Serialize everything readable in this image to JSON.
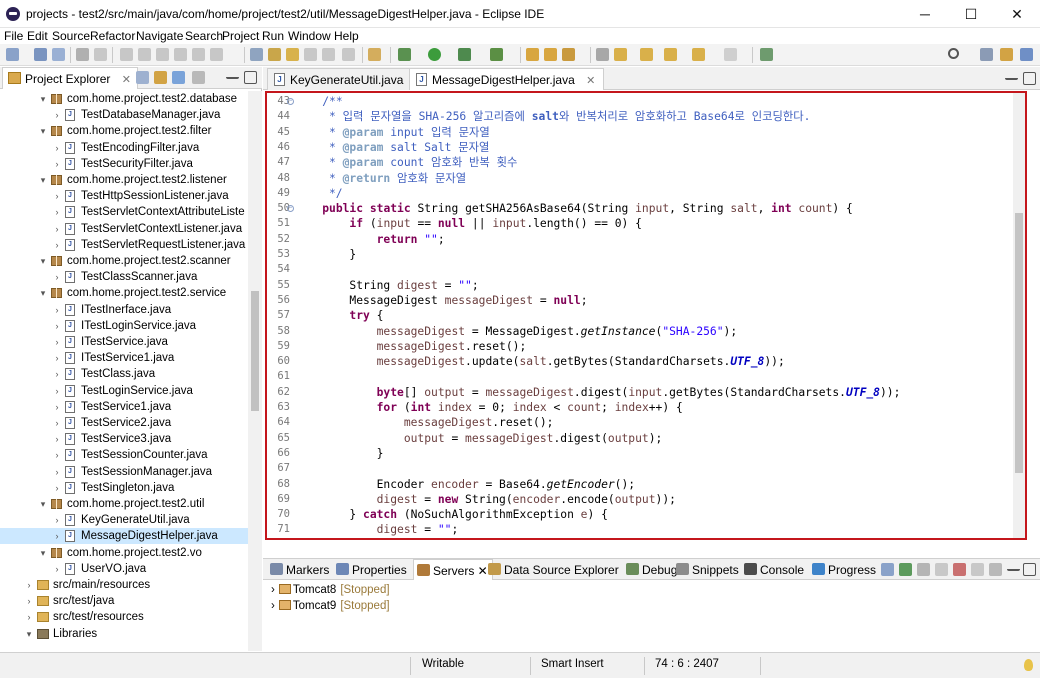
{
  "window": {
    "title": "projects - test2/src/main/java/com/home/project/test2/util/MessageDigestHelper.java - Eclipse IDE",
    "minimize_glyph": "─",
    "maximize_glyph": "☐",
    "close_glyph": "✕"
  },
  "menu": [
    "File",
    "Edit",
    "Source",
    "Refactor",
    "Navigate",
    "Search",
    "Project",
    "Run",
    "Window",
    "Help"
  ],
  "project_explorer": {
    "title": "Project Explorer",
    "close_glyph": "✕",
    "rows": [
      {
        "kind": "package",
        "label": "com.home.project.test2.database",
        "indent": 3,
        "arrow": "▾"
      },
      {
        "kind": "file",
        "label": "TestDatabaseManager.java",
        "indent": 4,
        "arrow": "›"
      },
      {
        "kind": "package",
        "label": "com.home.project.test2.filter",
        "indent": 3,
        "arrow": "▾"
      },
      {
        "kind": "file",
        "label": "TestEncodingFilter.java",
        "indent": 4,
        "arrow": "›"
      },
      {
        "kind": "file",
        "label": "TestSecurityFilter.java",
        "indent": 4,
        "arrow": "›"
      },
      {
        "kind": "package",
        "label": "com.home.project.test2.listener",
        "indent": 3,
        "arrow": "▾"
      },
      {
        "kind": "file",
        "label": "TestHttpSessionListener.java",
        "indent": 4,
        "arrow": "›"
      },
      {
        "kind": "file",
        "label": "TestServletContextAttributeListe",
        "indent": 4,
        "arrow": "›"
      },
      {
        "kind": "file",
        "label": "TestServletContextListener.java",
        "indent": 4,
        "arrow": "›"
      },
      {
        "kind": "file",
        "label": "TestServletRequestListener.java",
        "indent": 4,
        "arrow": "›"
      },
      {
        "kind": "package",
        "label": "com.home.project.test2.scanner",
        "indent": 3,
        "arrow": "▾"
      },
      {
        "kind": "file",
        "label": "TestClassScanner.java",
        "indent": 4,
        "arrow": "›"
      },
      {
        "kind": "package",
        "label": "com.home.project.test2.service",
        "indent": 3,
        "arrow": "▾"
      },
      {
        "kind": "ifile",
        "label": "ITestInerface.java",
        "indent": 4,
        "arrow": "›"
      },
      {
        "kind": "ifile",
        "label": "ITestLoginService.java",
        "indent": 4,
        "arrow": "›"
      },
      {
        "kind": "ifile",
        "label": "ITestService.java",
        "indent": 4,
        "arrow": "›"
      },
      {
        "kind": "ifile",
        "label": "ITestService1.java",
        "indent": 4,
        "arrow": "›"
      },
      {
        "kind": "file",
        "label": "TestClass.java",
        "indent": 4,
        "arrow": "›"
      },
      {
        "kind": "file",
        "label": "TestLoginService.java",
        "indent": 4,
        "arrow": "›"
      },
      {
        "kind": "file",
        "label": "TestService1.java",
        "indent": 4,
        "arrow": "›"
      },
      {
        "kind": "file",
        "label": "TestService2.java",
        "indent": 4,
        "arrow": "›"
      },
      {
        "kind": "file",
        "label": "TestService3.java",
        "indent": 4,
        "arrow": "›"
      },
      {
        "kind": "file",
        "label": "TestSessionCounter.java",
        "indent": 4,
        "arrow": "›"
      },
      {
        "kind": "file",
        "label": "TestSessionManager.java",
        "indent": 4,
        "arrow": "›"
      },
      {
        "kind": "file",
        "label": "TestSingleton.java",
        "indent": 4,
        "arrow": "›"
      },
      {
        "kind": "package",
        "label": "com.home.project.test2.util",
        "indent": 3,
        "arrow": "▾"
      },
      {
        "kind": "file",
        "label": "KeyGenerateUtil.java",
        "indent": 4,
        "arrow": "›"
      },
      {
        "kind": "file",
        "label": "MessageDigestHelper.java",
        "indent": 4,
        "arrow": "›",
        "selected": true
      },
      {
        "kind": "package",
        "label": "com.home.project.test2.vo",
        "indent": 3,
        "arrow": "▾"
      },
      {
        "kind": "file",
        "label": "UserVO.java",
        "indent": 4,
        "arrow": "›"
      },
      {
        "kind": "folder",
        "label": "src/main/resources",
        "indent": 2,
        "arrow": "›"
      },
      {
        "kind": "folder",
        "label": "src/test/java",
        "indent": 2,
        "arrow": "›"
      },
      {
        "kind": "folder",
        "label": "src/test/resources",
        "indent": 2,
        "arrow": "›"
      },
      {
        "kind": "library",
        "label": "Libraries",
        "indent": 2,
        "arrow": "▾"
      }
    ]
  },
  "editor": {
    "tabs": [
      {
        "label": "KeyGenerateUtil.java",
        "active": false
      },
      {
        "label": "MessageDigestHelper.java",
        "active": true
      }
    ],
    "lines": [
      {
        "n": "43",
        "fold": "⊖",
        "tokens": [
          [
            "",
            "    "
          ],
          [
            "c-com",
            "/**"
          ]
        ]
      },
      {
        "n": "44",
        "tokens": [
          [
            "c-com",
            "     * 입력 문자열을 SHA-256 알고리즘에 "
          ],
          [
            "c-com c-bold",
            "salt"
          ],
          [
            "c-com",
            "와 반복처리로 암호화하고 Base64로 인코딩한다."
          ]
        ]
      },
      {
        "n": "45",
        "tokens": [
          [
            "c-com",
            "     * "
          ],
          [
            "c-tag",
            "@param"
          ],
          [
            "c-com",
            " input 입력 문자열"
          ]
        ]
      },
      {
        "n": "46",
        "tokens": [
          [
            "c-com",
            "     * "
          ],
          [
            "c-tag",
            "@param"
          ],
          [
            "c-com",
            " salt Salt 문자열"
          ]
        ]
      },
      {
        "n": "47",
        "tokens": [
          [
            "c-com",
            "     * "
          ],
          [
            "c-tag",
            "@param"
          ],
          [
            "c-com",
            " count 암호화 반복 횟수"
          ]
        ]
      },
      {
        "n": "48",
        "tokens": [
          [
            "c-com",
            "     * "
          ],
          [
            "c-tag",
            "@return"
          ],
          [
            "c-com",
            " 암호화 문자열"
          ]
        ]
      },
      {
        "n": "49",
        "tokens": [
          [
            "c-com",
            "     */"
          ]
        ]
      },
      {
        "n": "50",
        "fold": "⊖",
        "tokens": [
          [
            "",
            "    "
          ],
          [
            "c-kw",
            "public"
          ],
          [
            "",
            " "
          ],
          [
            "c-kw",
            "static"
          ],
          [
            "",
            " String getSHA256AsBase64(String "
          ],
          [
            "c-var",
            "input"
          ],
          [
            "",
            ", String "
          ],
          [
            "c-var",
            "salt"
          ],
          [
            "",
            ", "
          ],
          [
            "c-kw",
            "int"
          ],
          [
            "",
            " "
          ],
          [
            "c-var",
            "count"
          ],
          [
            "",
            ") {"
          ]
        ]
      },
      {
        "n": "51",
        "tokens": [
          [
            "",
            "        "
          ],
          [
            "c-kw",
            "if"
          ],
          [
            "",
            " ("
          ],
          [
            "c-var",
            "input"
          ],
          [
            "",
            " == "
          ],
          [
            "c-kw",
            "null"
          ],
          [
            "",
            " || "
          ],
          [
            "c-var",
            "input"
          ],
          [
            "",
            ".length() == 0) {"
          ]
        ]
      },
      {
        "n": "52",
        "tokens": [
          [
            "",
            "            "
          ],
          [
            "c-kw",
            "return"
          ],
          [
            "",
            " "
          ],
          [
            "c-str",
            "\"\""
          ],
          [
            "",
            ";"
          ]
        ]
      },
      {
        "n": "53",
        "tokens": [
          [
            "",
            "        }"
          ]
        ]
      },
      {
        "n": "54",
        "tokens": [
          [
            "",
            ""
          ]
        ]
      },
      {
        "n": "55",
        "tokens": [
          [
            "",
            "        String "
          ],
          [
            "c-var",
            "digest"
          ],
          [
            "",
            " = "
          ],
          [
            "c-str",
            "\"\""
          ],
          [
            "",
            ";"
          ]
        ]
      },
      {
        "n": "56",
        "tokens": [
          [
            "",
            "        MessageDigest "
          ],
          [
            "c-var",
            "messageDigest"
          ],
          [
            "",
            " = "
          ],
          [
            "c-kw",
            "null"
          ],
          [
            "",
            ";"
          ]
        ]
      },
      {
        "n": "57",
        "tokens": [
          [
            "",
            "        "
          ],
          [
            "c-kw",
            "try"
          ],
          [
            "",
            " {"
          ]
        ]
      },
      {
        "n": "58",
        "tokens": [
          [
            "",
            "            "
          ],
          [
            "c-var",
            "messageDigest"
          ],
          [
            "",
            " = MessageDigest."
          ],
          [
            "c-static",
            "getInstance"
          ],
          [
            "",
            "("
          ],
          [
            "c-str",
            "\"SHA-256\""
          ],
          [
            "",
            ");"
          ]
        ]
      },
      {
        "n": "59",
        "tokens": [
          [
            "",
            "            "
          ],
          [
            "c-var",
            "messageDigest"
          ],
          [
            "",
            ".reset();"
          ]
        ]
      },
      {
        "n": "60",
        "tokens": [
          [
            "",
            "            "
          ],
          [
            "c-var",
            "messageDigest"
          ],
          [
            "",
            ".update("
          ],
          [
            "c-var",
            "salt"
          ],
          [
            "",
            ".getBytes(StandardCharsets."
          ],
          [
            "c-sfld",
            "UTF_8"
          ],
          [
            "",
            "));"
          ]
        ]
      },
      {
        "n": "61",
        "tokens": [
          [
            "",
            ""
          ]
        ]
      },
      {
        "n": "62",
        "tokens": [
          [
            "",
            "            "
          ],
          [
            "c-kw",
            "byte"
          ],
          [
            "",
            "[] "
          ],
          [
            "c-var",
            "output"
          ],
          [
            "",
            " = "
          ],
          [
            "c-var",
            "messageDigest"
          ],
          [
            "",
            ".digest("
          ],
          [
            "c-var",
            "input"
          ],
          [
            "",
            ".getBytes(StandardCharsets."
          ],
          [
            "c-sfld",
            "UTF_8"
          ],
          [
            "",
            "));"
          ]
        ]
      },
      {
        "n": "63",
        "tokens": [
          [
            "",
            "            "
          ],
          [
            "c-kw",
            "for"
          ],
          [
            "",
            " ("
          ],
          [
            "c-kw",
            "int"
          ],
          [
            "",
            " "
          ],
          [
            "c-var",
            "index"
          ],
          [
            "",
            " = 0; "
          ],
          [
            "c-var",
            "index"
          ],
          [
            "",
            " < "
          ],
          [
            "c-var",
            "count"
          ],
          [
            "",
            "; "
          ],
          [
            "c-var",
            "index"
          ],
          [
            "",
            "++) {"
          ]
        ]
      },
      {
        "n": "64",
        "tokens": [
          [
            "",
            "                "
          ],
          [
            "c-var",
            "messageDigest"
          ],
          [
            "",
            ".reset();"
          ]
        ]
      },
      {
        "n": "65",
        "tokens": [
          [
            "",
            "                "
          ],
          [
            "c-var",
            "output"
          ],
          [
            "",
            " = "
          ],
          [
            "c-var",
            "messageDigest"
          ],
          [
            "",
            ".digest("
          ],
          [
            "c-var",
            "output"
          ],
          [
            "",
            ");"
          ]
        ]
      },
      {
        "n": "66",
        "tokens": [
          [
            "",
            "            }"
          ]
        ]
      },
      {
        "n": "67",
        "tokens": [
          [
            "",
            ""
          ]
        ]
      },
      {
        "n": "68",
        "tokens": [
          [
            "",
            "            Encoder "
          ],
          [
            "c-var",
            "encoder"
          ],
          [
            "",
            " = Base64."
          ],
          [
            "c-static",
            "getEncoder"
          ],
          [
            "",
            "();"
          ]
        ]
      },
      {
        "n": "69",
        "tokens": [
          [
            "",
            "            "
          ],
          [
            "c-var",
            "digest"
          ],
          [
            "",
            " = "
          ],
          [
            "c-kw",
            "new"
          ],
          [
            "",
            " String("
          ],
          [
            "c-var",
            "encoder"
          ],
          [
            "",
            ".encode("
          ],
          [
            "c-var",
            "output"
          ],
          [
            "",
            "));"
          ]
        ]
      },
      {
        "n": "70",
        "tokens": [
          [
            "",
            "        } "
          ],
          [
            "c-kw",
            "catch"
          ],
          [
            "",
            " (NoSuchAlgorithmException "
          ],
          [
            "c-var",
            "e"
          ],
          [
            "",
            ") {"
          ]
        ]
      },
      {
        "n": "71",
        "tokens": [
          [
            "",
            "            "
          ],
          [
            "c-var",
            "digest"
          ],
          [
            "",
            " = "
          ],
          [
            "c-str",
            "\"\""
          ],
          [
            "",
            ";"
          ]
        ]
      }
    ]
  },
  "bottom_panel": {
    "tabs": [
      {
        "label": "Markers",
        "icon": "markers-icon",
        "color": "#7a8aa8",
        "active": false
      },
      {
        "label": "Properties",
        "icon": "properties-icon",
        "color": "#6d87b6",
        "active": false
      },
      {
        "label": "Servers ✕",
        "icon": "servers-icon",
        "color": "#b07a3a",
        "active": true
      },
      {
        "label": "Data Source Explorer",
        "icon": "datasource-icon",
        "color": "#c29a4a",
        "active": false
      },
      {
        "label": "Debug",
        "icon": "debug-icon",
        "color": "#6a8d5a",
        "active": false
      },
      {
        "label": "Snippets",
        "icon": "snippets-icon",
        "color": "#8c8c8c",
        "active": false
      },
      {
        "label": "Console",
        "icon": "console-icon",
        "color": "#4c4c4c",
        "active": false
      },
      {
        "label": "Progress",
        "icon": "progress-icon",
        "color": "#3e83c9",
        "active": false
      }
    ],
    "servers": [
      {
        "name": "Tomcat8",
        "status": "[Stopped]"
      },
      {
        "name": "Tomcat9",
        "status": "[Stopped]"
      }
    ]
  },
  "status_bar": {
    "mode": "Writable",
    "insert": "Smart Insert",
    "position": "74 : 6 : 2407"
  },
  "colors": {
    "editor_highlight_border": "#c4161c",
    "selection": "#cce8ff"
  }
}
